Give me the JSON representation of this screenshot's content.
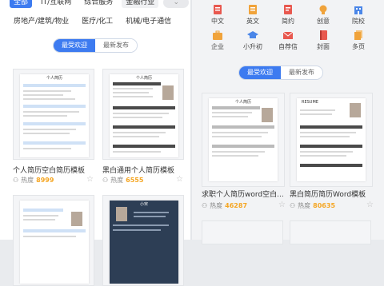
{
  "categories": {
    "row1": [
      "全部",
      "IT/互联网",
      "综合服务",
      "金融行业"
    ],
    "row2": [
      "房地产/建筑/物业",
      "医疗/化工",
      "机械/电子通信"
    ]
  },
  "tabs": [
    "最受欢迎",
    "最新发布"
  ],
  "left_cards": [
    {
      "title": "个人简历空白简历模板",
      "heat_label": "热度",
      "heat": "8999",
      "doc_title": "个人简历"
    },
    {
      "title": "黑白通用个人简历模板",
      "heat_label": "热度",
      "heat": "6555",
      "doc_title": "个人简历"
    },
    {
      "title": "",
      "heat_label": "",
      "heat": "",
      "doc_title": ""
    },
    {
      "title": "",
      "heat_label": "",
      "heat": "",
      "doc_title": "小宋"
    }
  ],
  "icons": [
    {
      "label": "中文",
      "icon": "doc-icon",
      "color": "#e8584f"
    },
    {
      "label": "英文",
      "icon": "doc-icon",
      "color": "#f0a33b"
    },
    {
      "label": "简约",
      "icon": "doc-icon",
      "color": "#e8584f"
    },
    {
      "label": "创意",
      "icon": "bulb-icon",
      "color": "#f0a33b"
    },
    {
      "label": "院校",
      "icon": "building-icon",
      "color": "#4a86e8"
    },
    {
      "label": "企业",
      "icon": "briefcase-icon",
      "color": "#f0a33b"
    },
    {
      "label": "小升初",
      "icon": "graduation-cap-icon",
      "color": "#4a86e8"
    },
    {
      "label": "自荐信",
      "icon": "envelope-icon",
      "color": "#e8584f"
    },
    {
      "label": "封面",
      "icon": "book-icon",
      "color": "#e8584f"
    },
    {
      "label": "多页",
      "icon": "pages-icon",
      "color": "#f0a33b"
    }
  ],
  "right_cards": [
    {
      "title": "求职个人简历word空白...",
      "heat_label": "热度",
      "heat": "46287",
      "doc_title": "个人简历"
    },
    {
      "title": "黑白简历简历Word模板",
      "heat_label": "热度",
      "heat": "80635",
      "doc_title": "RESUME"
    }
  ]
}
